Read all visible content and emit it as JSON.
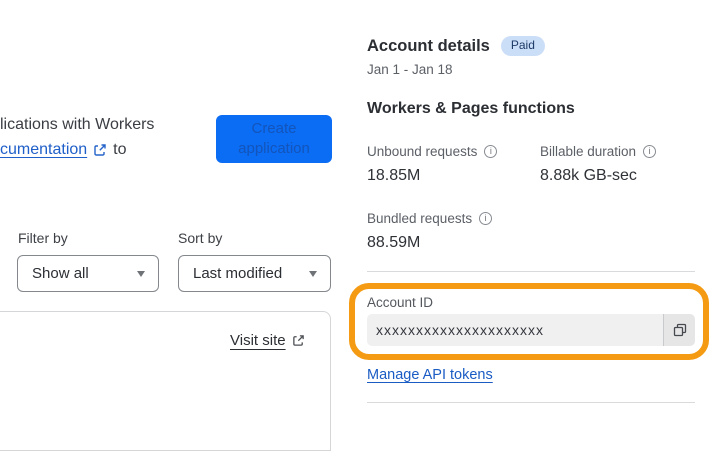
{
  "left_panel": {
    "intro_fragment_line1": "lications with Workers",
    "intro_link_text": "cumentation",
    "intro_after_link": "to",
    "create_button_label": "Create application",
    "filter": {
      "label": "Filter by",
      "selected": "Show all"
    },
    "sort": {
      "label": "Sort by",
      "selected": "Last modified"
    },
    "project_card": {
      "visit_site_label": "Visit site"
    }
  },
  "account_panel": {
    "title": "Account details",
    "plan_badge": "Paid",
    "date_range": "Jan 1 - Jan 18",
    "section_heading": "Workers & Pages functions",
    "metrics": [
      {
        "label": "Unbound requests",
        "value": "18.85M"
      },
      {
        "label": "Billable duration",
        "value": "8.88k GB-sec"
      },
      {
        "label": "Bundled requests",
        "value": "88.59M"
      }
    ],
    "account_id": {
      "label": "Account ID",
      "value": "xxxxxxxxxxxxxxxxxxxxx"
    },
    "manage_api_tokens_label": "Manage API tokens"
  },
  "icons": {
    "info": "i",
    "external_link": "external-link",
    "chevron_down": "chevron-down",
    "copy": "copy"
  },
  "colors": {
    "button_blue": "#0b6cf4",
    "button_text_blue": "#1355ba",
    "link_blue": "#1b5cc4",
    "badge_bg": "#cbdef8",
    "badge_text": "#1d3a66",
    "highlight_orange": "#f49b13",
    "input_bg": "#f0f0f1",
    "divider": "#d8dadc"
  }
}
